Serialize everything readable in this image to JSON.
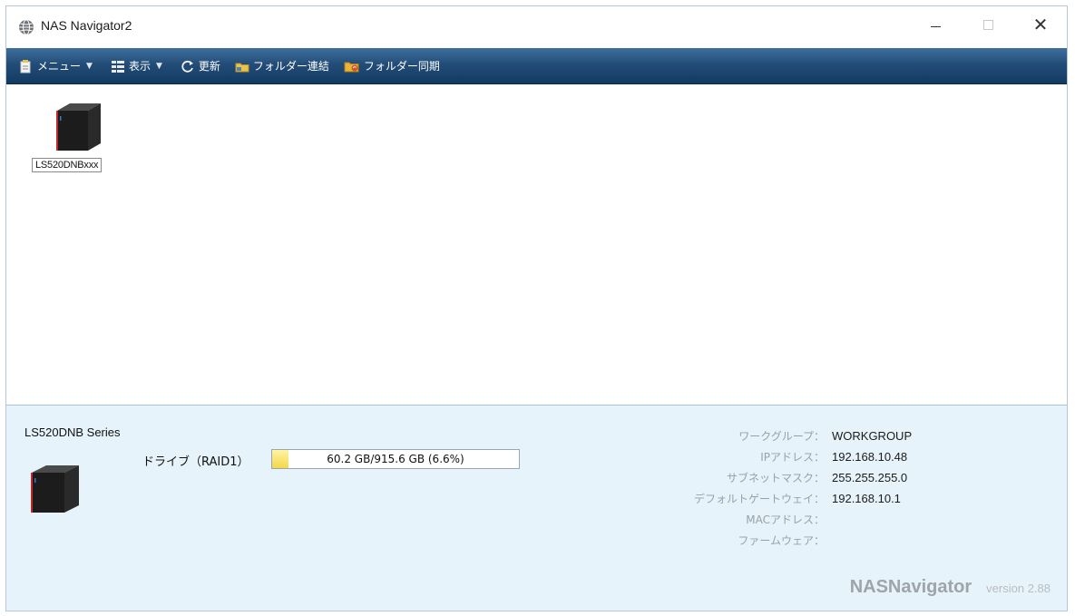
{
  "window": {
    "title": "NAS Navigator2",
    "minimize_icon": "minimize-icon",
    "maximize_icon": "maximize-icon",
    "close_symbol": "✕"
  },
  "toolbar": {
    "items": [
      {
        "label": "メニュー",
        "icon": "menu-icon",
        "has_dropdown": true
      },
      {
        "label": "表示",
        "icon": "view-icon",
        "has_dropdown": true
      },
      {
        "label": "更新",
        "icon": "refresh-icon",
        "has_dropdown": false
      },
      {
        "label": "フォルダー連結",
        "icon": "folder-link-icon",
        "has_dropdown": false
      },
      {
        "label": "フォルダー同期",
        "icon": "folder-sync-icon",
        "has_dropdown": false
      }
    ],
    "caret": "▼"
  },
  "devices": [
    {
      "name": "LS520DNBxxx",
      "icon": "nas-device-icon"
    }
  ],
  "detail": {
    "series": "LS520DNB Series",
    "drive_label": "ドライブ（RAID1）",
    "drive_usage_text": "60.2 GB/915.6 GB (6.6%)",
    "drive_usage_fraction": 0.066,
    "info": [
      {
        "label": "ワークグループ：",
        "value": "WORKGROUP"
      },
      {
        "label": "IPアドレス：",
        "value": "192.168.10.48"
      },
      {
        "label": "サブネットマスク：",
        "value": "255.255.255.0"
      },
      {
        "label": "デフォルトゲートウェイ：",
        "value": "192.168.10.1"
      },
      {
        "label": "MACアドレス：",
        "value": ""
      },
      {
        "label": "ファームウェア：",
        "value": ""
      }
    ],
    "brand": "NASNavigator",
    "version": "version 2.88"
  },
  "colors": {
    "toolbar_top": "#3f6f9e",
    "toolbar_bottom": "#123a63",
    "detail_bg": "#e6f3fa",
    "drive_fill": "#f1d84a"
  }
}
